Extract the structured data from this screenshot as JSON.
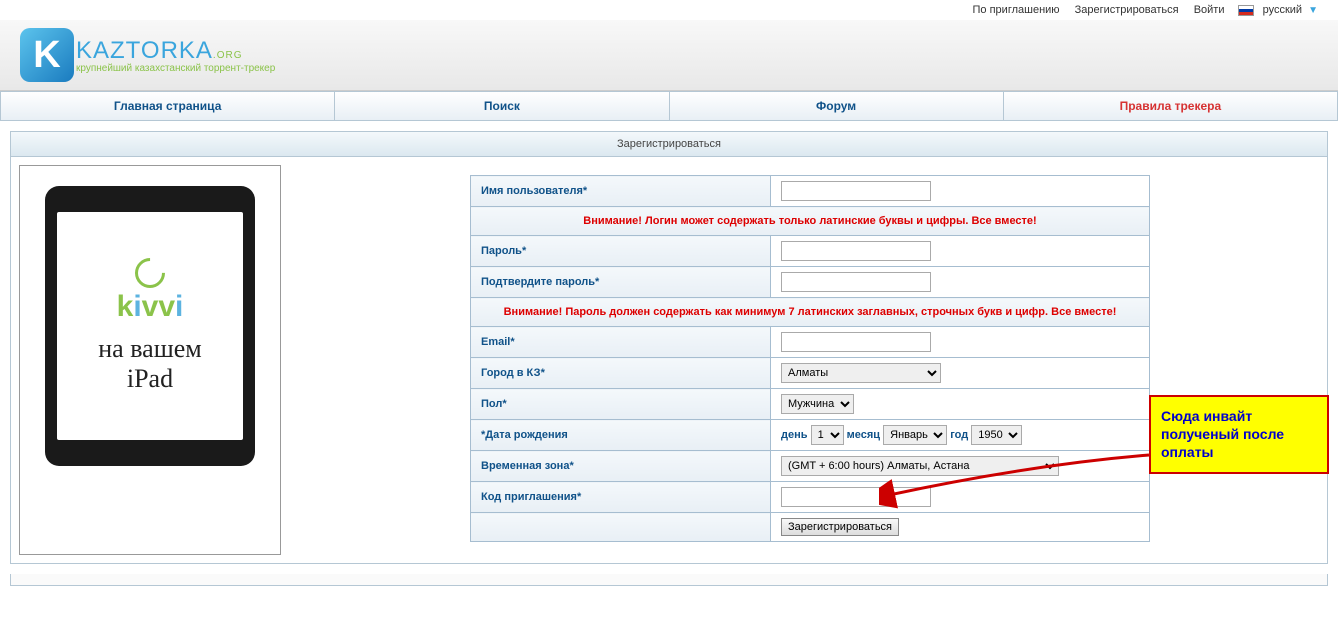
{
  "topbar": {
    "invite": "По приглашению",
    "register": "Зарегистрироваться",
    "login": "Войти",
    "lang": "русский"
  },
  "logo": {
    "main": "KAZTORKA",
    "suffix": ".ORG",
    "tagline": "крупнейший казахстанский торрент-трекер"
  },
  "nav": {
    "home": "Главная страница",
    "search": "Поиск",
    "forum": "Форум",
    "rules": "Правила трекера"
  },
  "section_title": "Зарегистрироваться",
  "form": {
    "username_label": "Имя пользователя*",
    "warn_login": "Внимание! Логин может содержать только латинские буквы и цифры. Все вместе!",
    "password_label": "Пароль*",
    "confirm_label": "Подтвердите пароль*",
    "warn_password": "Внимание! Пароль должен содержать как минимум 7 латинских заглавных, строчных букв и цифр. Все вместе!",
    "email_label": "Email*",
    "city_label": "Город в КЗ*",
    "city_value": "Алматы",
    "gender_label": "Пол*",
    "gender_value": "Мужчина",
    "dob_label": "*Дата рождения",
    "day_label": "день",
    "day_value": "1",
    "month_label": "месяц",
    "month_value": "Январь",
    "year_label": "год",
    "year_value": "1950",
    "tz_label": "Временная зона*",
    "tz_value": "(GMT + 6:00 hours) Алматы, Астана",
    "invite_label": "Код приглашения*",
    "submit": "Зарегистрироваться"
  },
  "ad": {
    "brand_k": "k",
    "brand_i1": "i",
    "brand_v1": "v",
    "brand_v2": "v",
    "brand_i2": "i",
    "line1": "на вашем",
    "line2": "iPad"
  },
  "callout": "Сюда инвайт полученый после оплаты"
}
